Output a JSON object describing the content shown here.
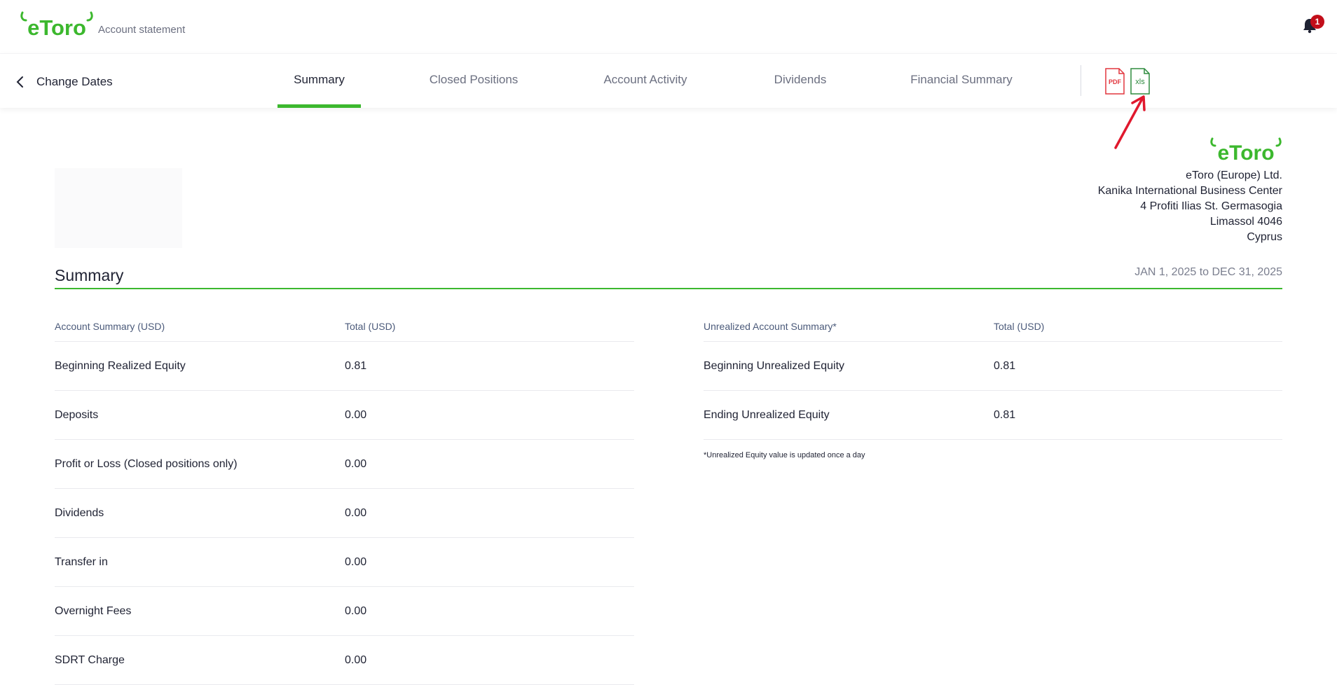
{
  "header": {
    "subtitle": "Account statement",
    "notification_count": "1"
  },
  "nav": {
    "back_label": "Change Dates",
    "tabs": [
      {
        "label": "Summary",
        "active": true
      },
      {
        "label": "Closed Positions",
        "active": false
      },
      {
        "label": "Account Activity",
        "active": false
      },
      {
        "label": "Dividends",
        "active": false
      },
      {
        "label": "Financial Summary",
        "active": false
      }
    ],
    "downloads": {
      "pdf": "PDF",
      "xls": "xls"
    }
  },
  "company": {
    "lines": [
      "eToro (Europe) Ltd.",
      "Kanika International Business Center",
      "4 Profiti Ilias St. Germasogia",
      "Limassol 4046",
      "Cyprus"
    ]
  },
  "summary": {
    "title": "Summary",
    "date_range": "JAN 1, 2025 to DEC 31, 2025"
  },
  "account_summary": {
    "headers": [
      "Account Summary (USD)",
      "Total (USD)"
    ],
    "rows": [
      [
        "Beginning Realized Equity",
        "0.81"
      ],
      [
        "Deposits",
        "0.00"
      ],
      [
        "Profit or Loss (Closed positions only)",
        "0.00"
      ],
      [
        "Dividends",
        "0.00"
      ],
      [
        "Transfer in",
        "0.00"
      ],
      [
        "Overnight Fees",
        "0.00"
      ],
      [
        "SDRT Charge",
        "0.00"
      ]
    ]
  },
  "unrealized_summary": {
    "headers": [
      "Unrealized Account Summary*",
      "Total (USD)"
    ],
    "rows": [
      [
        "Beginning Unrealized Equity",
        "0.81"
      ],
      [
        "Ending Unrealized Equity",
        "0.81"
      ]
    ],
    "footnote": "*Unrealized Equity value is updated once a day"
  },
  "colors": {
    "brand_green": "#3cb82e",
    "pdf_red": "#e2363e",
    "xls_green": "#2e8b3f",
    "annotation_red": "#e0182d"
  }
}
